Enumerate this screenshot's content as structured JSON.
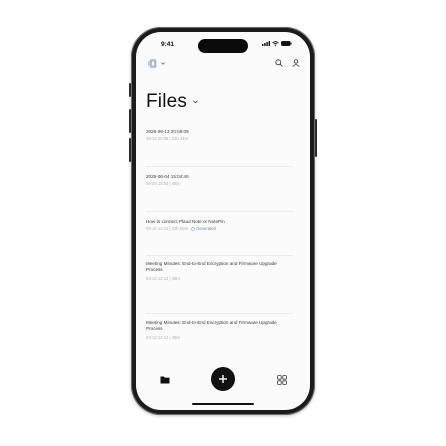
{
  "status_bar": {
    "time": "9:41"
  },
  "page": {
    "title": "Files"
  },
  "files": [
    {
      "title": "2025-08-13 20:06:09",
      "meta": "08-13 20:06  |  24h 44m",
      "generated": ""
    },
    {
      "title": "2025-06-04 15:04:46",
      "meta": "06-04 15:04  |  48m",
      "generated": ""
    },
    {
      "title": "How to connect Plaud Note or NotePin",
      "meta": "03-12 14:12  |  23h 59m",
      "generated": "Generated"
    },
    {
      "title": "Meeting Minutes: End-to-End Encryption and Firmware Upgrade Process",
      "meta": "03-12 14:12  |  45m",
      "generated": ""
    },
    {
      "title": "Meeting Minutes: End-to-End Encryption and Firmware Upgrade Process",
      "meta": "03-12 14:12  |  45m",
      "generated": ""
    }
  ],
  "icons": {
    "device": "device-icon",
    "device_dropdown": "chevron-down-icon",
    "title_dropdown": "chevron-down-icon",
    "search": "search-icon",
    "profile": "person-icon",
    "files_tab": "folder-icon",
    "add": "plus-icon",
    "templates_tab": "grid-icon"
  },
  "colors": {
    "accent": "#111111",
    "generated": "#5b8fd6"
  }
}
